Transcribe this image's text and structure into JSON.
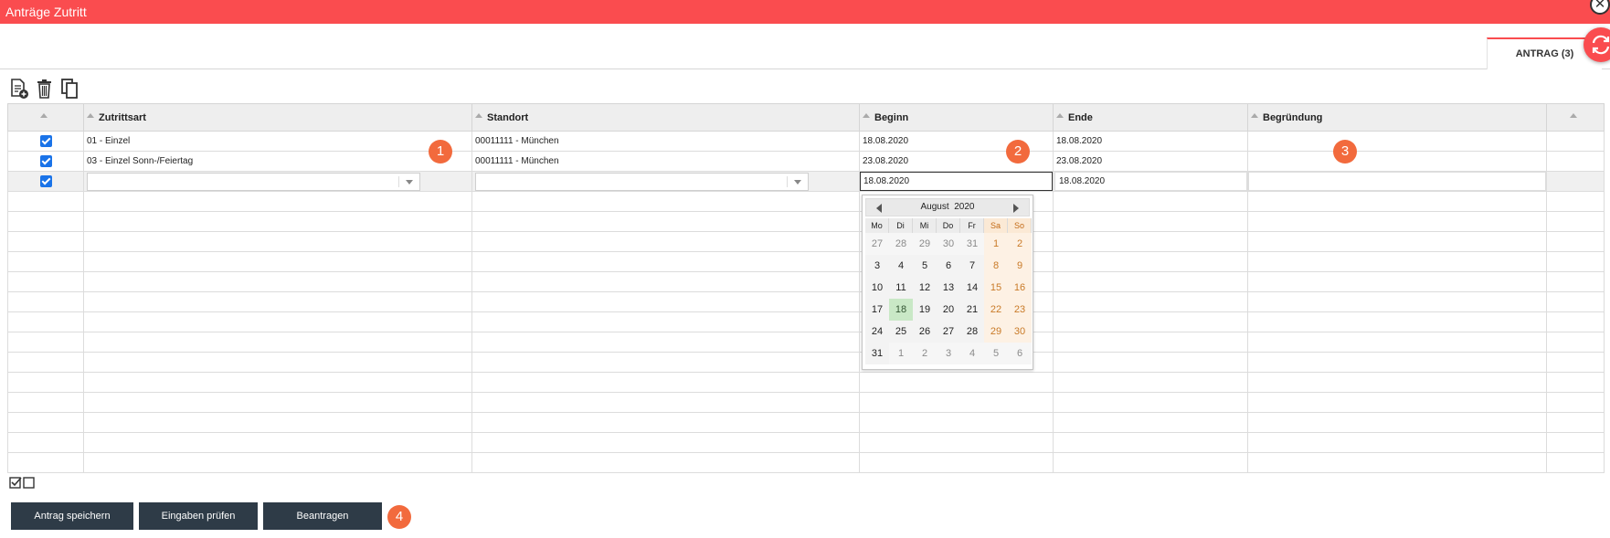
{
  "window": {
    "title": "Anträge Zutritt",
    "close_glyph": "✕"
  },
  "tab": {
    "label": "ANTRAG (3)"
  },
  "toolbar": {
    "icons": [
      "new-document-icon",
      "trash-icon",
      "copy-icon"
    ]
  },
  "grid": {
    "columns": [
      "Zutrittsart",
      "Standort",
      "Beginn",
      "Ende",
      "Begründung"
    ],
    "rows": [
      {
        "checked": true,
        "zutrittsart": "01 - Einzel",
        "standort": "00011111 - München",
        "beginn": "18.08.2020",
        "ende": "18.08.2020",
        "begruendung": ""
      },
      {
        "checked": true,
        "zutrittsart": "03 - Einzel Sonn-/Feiertag",
        "standort": "00011111 - München",
        "beginn": "23.08.2020",
        "ende": "23.08.2020",
        "begruendung": ""
      }
    ],
    "edit_row": {
      "checked": true,
      "beginn": "18.08.2020",
      "ende": "18.08.2020"
    }
  },
  "datepicker": {
    "month": "August",
    "year": "2020",
    "weekdays": [
      "Mo",
      "Di",
      "Mi",
      "Do",
      "Fr",
      "Sa",
      "So"
    ],
    "weeks": [
      [
        "27",
        "28",
        "29",
        "30",
        "31",
        "1",
        "2"
      ],
      [
        "3",
        "4",
        "5",
        "6",
        "7",
        "8",
        "9"
      ],
      [
        "10",
        "11",
        "12",
        "13",
        "14",
        "15",
        "16"
      ],
      [
        "17",
        "18",
        "19",
        "20",
        "21",
        "22",
        "23"
      ],
      [
        "24",
        "25",
        "26",
        "27",
        "28",
        "29",
        "30"
      ],
      [
        "31",
        "1",
        "2",
        "3",
        "4",
        "5",
        "6"
      ]
    ],
    "selected_day": "18"
  },
  "badges": [
    "1",
    "2",
    "3",
    "4"
  ],
  "buttons": {
    "save": "Antrag speichern",
    "check": "Eingaben prüfen",
    "submit": "Beantragen"
  },
  "colors": {
    "accent": "#fa4c4f",
    "badge": "#f26a3d",
    "button": "#2e3b47",
    "checkbox": "#1a73e8"
  }
}
